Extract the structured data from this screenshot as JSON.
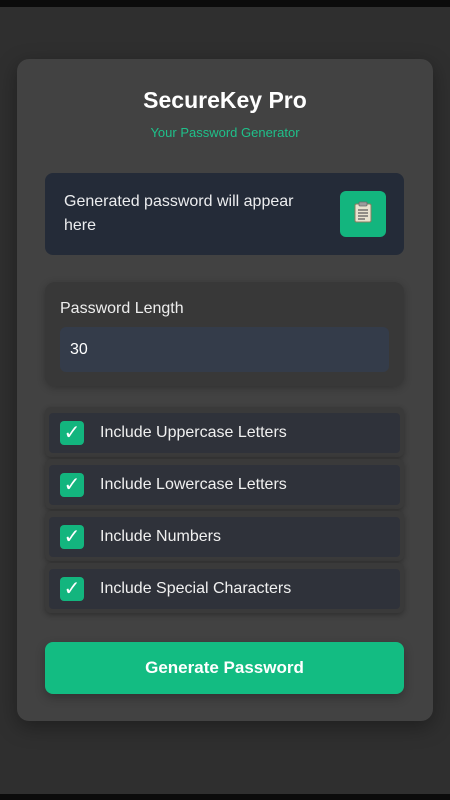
{
  "app": {
    "title": "SecureKey Pro",
    "subtitle": "Your Password Generator"
  },
  "password": {
    "display_text": "Generated password will appear here",
    "copy_icon": "clipboard-icon"
  },
  "length": {
    "label": "Password Length",
    "value": "30"
  },
  "options": [
    {
      "label": "Include Uppercase Letters",
      "checked": true,
      "check_glyph": "✓"
    },
    {
      "label": "Include Lowercase Letters",
      "checked": true,
      "check_glyph": "✓"
    },
    {
      "label": "Include Numbers",
      "checked": true,
      "check_glyph": "✓"
    },
    {
      "label": "Include Special Characters",
      "checked": true,
      "check_glyph": "✓"
    }
  ],
  "actions": {
    "generate_label": "Generate Password"
  },
  "colors": {
    "accent": "#13b57e",
    "background": "#2f2f2f",
    "card": "#424242",
    "subtitle": "#1fc08a"
  }
}
